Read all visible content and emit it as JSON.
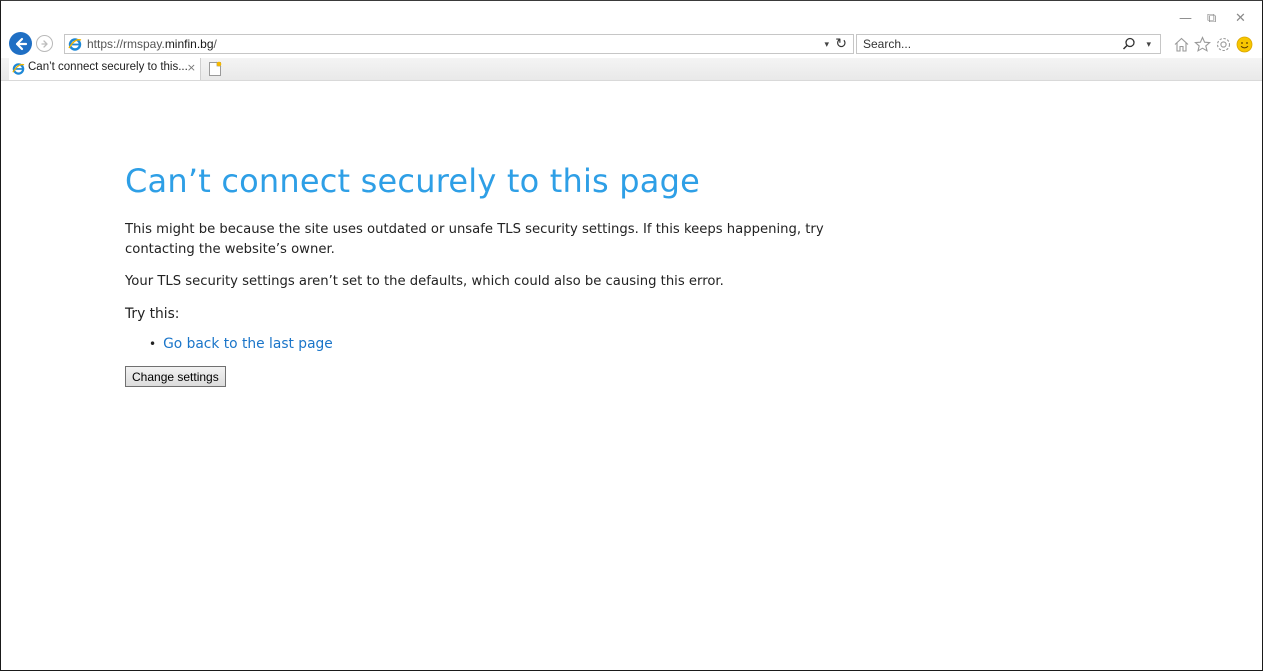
{
  "browser": {
    "url_prefix": "https://rmspay.",
    "url_host": "minfin.bg",
    "url_suffix": "/",
    "search_placeholder": "Search...",
    "window_controls": {
      "minimize": "—",
      "restore": "⧉",
      "close": "✕"
    }
  },
  "tabs": [
    {
      "title": "Can’t connect securely to this...",
      "close": "×"
    }
  ],
  "page": {
    "heading": "Can’t connect securely to this page",
    "para1": "This might be because the site uses outdated or unsafe TLS security settings. If this keeps happening, try contacting the website’s owner.",
    "para2": "Your TLS security settings aren’t set to the defaults, which could also be causing this error.",
    "try_label": "Try this:",
    "links": [
      "Go back to the last page"
    ],
    "button_label": "Change settings"
  },
  "colors": {
    "heading": "#2e9fe6",
    "link": "#1a75c9",
    "back_button": "#1f6fc4"
  }
}
